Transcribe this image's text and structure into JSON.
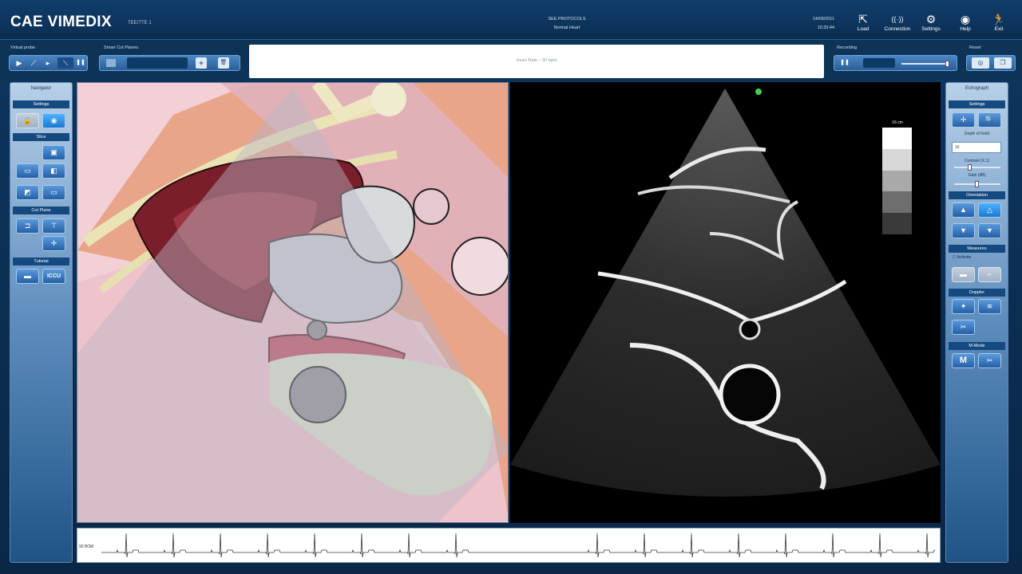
{
  "header": {
    "brand": "CAE VIMEDIX",
    "version": "TEE/TTE 1",
    "patient": "SEE PROTOCOLS",
    "case": "Normal Heart",
    "date": "14/09/2011",
    "time": "10:33:44",
    "buttons": [
      {
        "label": "Load",
        "icon": "load-icon",
        "glyph": "⇱"
      },
      {
        "label": "Connection",
        "icon": "connection-icon",
        "glyph": "((·))"
      },
      {
        "label": "Settings",
        "icon": "gear-icon",
        "glyph": "⚙"
      },
      {
        "label": "Help",
        "icon": "help-icon",
        "glyph": "◉"
      },
      {
        "label": "Exit",
        "icon": "exit-icon",
        "glyph": "🏃"
      }
    ]
  },
  "toolbar": {
    "virtual_probe_label": "Virtual probe",
    "smart_cut_label": "Smart Cut Planes",
    "message": "Heart Rate – 90 bpm",
    "recording_label": "Recording",
    "reset_label": "Reset",
    "probe_tools": [
      "▶",
      "⟋",
      "▸",
      "⟍",
      "❚❚"
    ]
  },
  "navigator": {
    "title": "Navigator",
    "sections": [
      "Settings",
      "Slice",
      "Cut Plane",
      "Tutorial"
    ],
    "tutorial_buttons": [
      "",
      "ICCU"
    ]
  },
  "echograph": {
    "title": "Echograph",
    "sections": [
      "Settings",
      "Orientation",
      "Measures",
      "Doppler",
      "M-Mode"
    ],
    "depth_label": "Depth of Field",
    "depth_value": "16",
    "contrast_label": "Contrast (X.1)",
    "gain_label": "Gain (dB)",
    "measure_checkbox": "Activate",
    "mmode_label": "M",
    "depth_scale": "16 cm"
  },
  "ecg": {
    "label": "90 BOM"
  },
  "colors": {
    "header_bg": "#0b2e52",
    "panel_accent": "#144a80",
    "button_blue": "#2460a5",
    "probe_marker": "#3bd24a"
  }
}
